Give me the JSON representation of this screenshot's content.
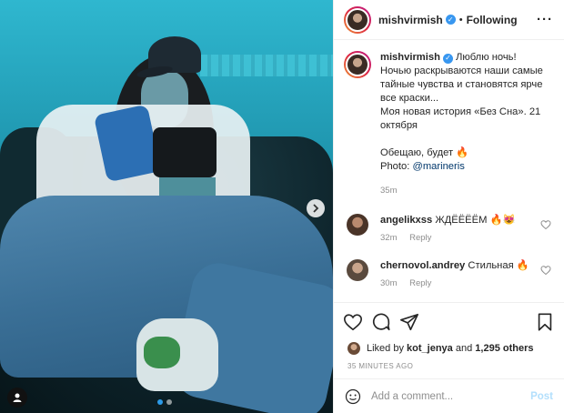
{
  "post": {
    "author": "mishvirmish",
    "follow_status": "Following",
    "dot": "•",
    "more_icon": "more-horizontal-icon"
  },
  "caption": {
    "line1": "Люблю ночь!",
    "line2": "Ночью раскрываются наши самые",
    "line3": "тайные чувства и становятся ярче",
    "line4": "все краски...",
    "line5": "Моя новая история «Без Сна». 21",
    "line6": "октября",
    "line7": "Обещаю, будет 🔥",
    "photo_prefix": "Photo:",
    "mention": "@marineris",
    "time": "35m"
  },
  "comments": [
    {
      "user": "angelikxss",
      "text": "ЖДЁЁЁЁМ 🔥😻",
      "time": "32m",
      "reply": "Reply"
    },
    {
      "user": "chernovol.andrey",
      "text": "Стильная 🔥",
      "time": "30m",
      "reply": "Reply"
    }
  ],
  "likes": {
    "prefix": "Liked by",
    "user": "kot_jenya",
    "and": "and",
    "others": "1,295 others"
  },
  "posted_ago": "35 MINUTES AGO",
  "add_comment": {
    "placeholder": "Add a comment...",
    "post_label": "Post"
  },
  "carousel": {
    "total": 2,
    "current": 1
  },
  "colors": {
    "verified": "#3897f0",
    "link": "#00376b",
    "post_button": "#b2dffc",
    "dot_active": "#2c9be8"
  }
}
